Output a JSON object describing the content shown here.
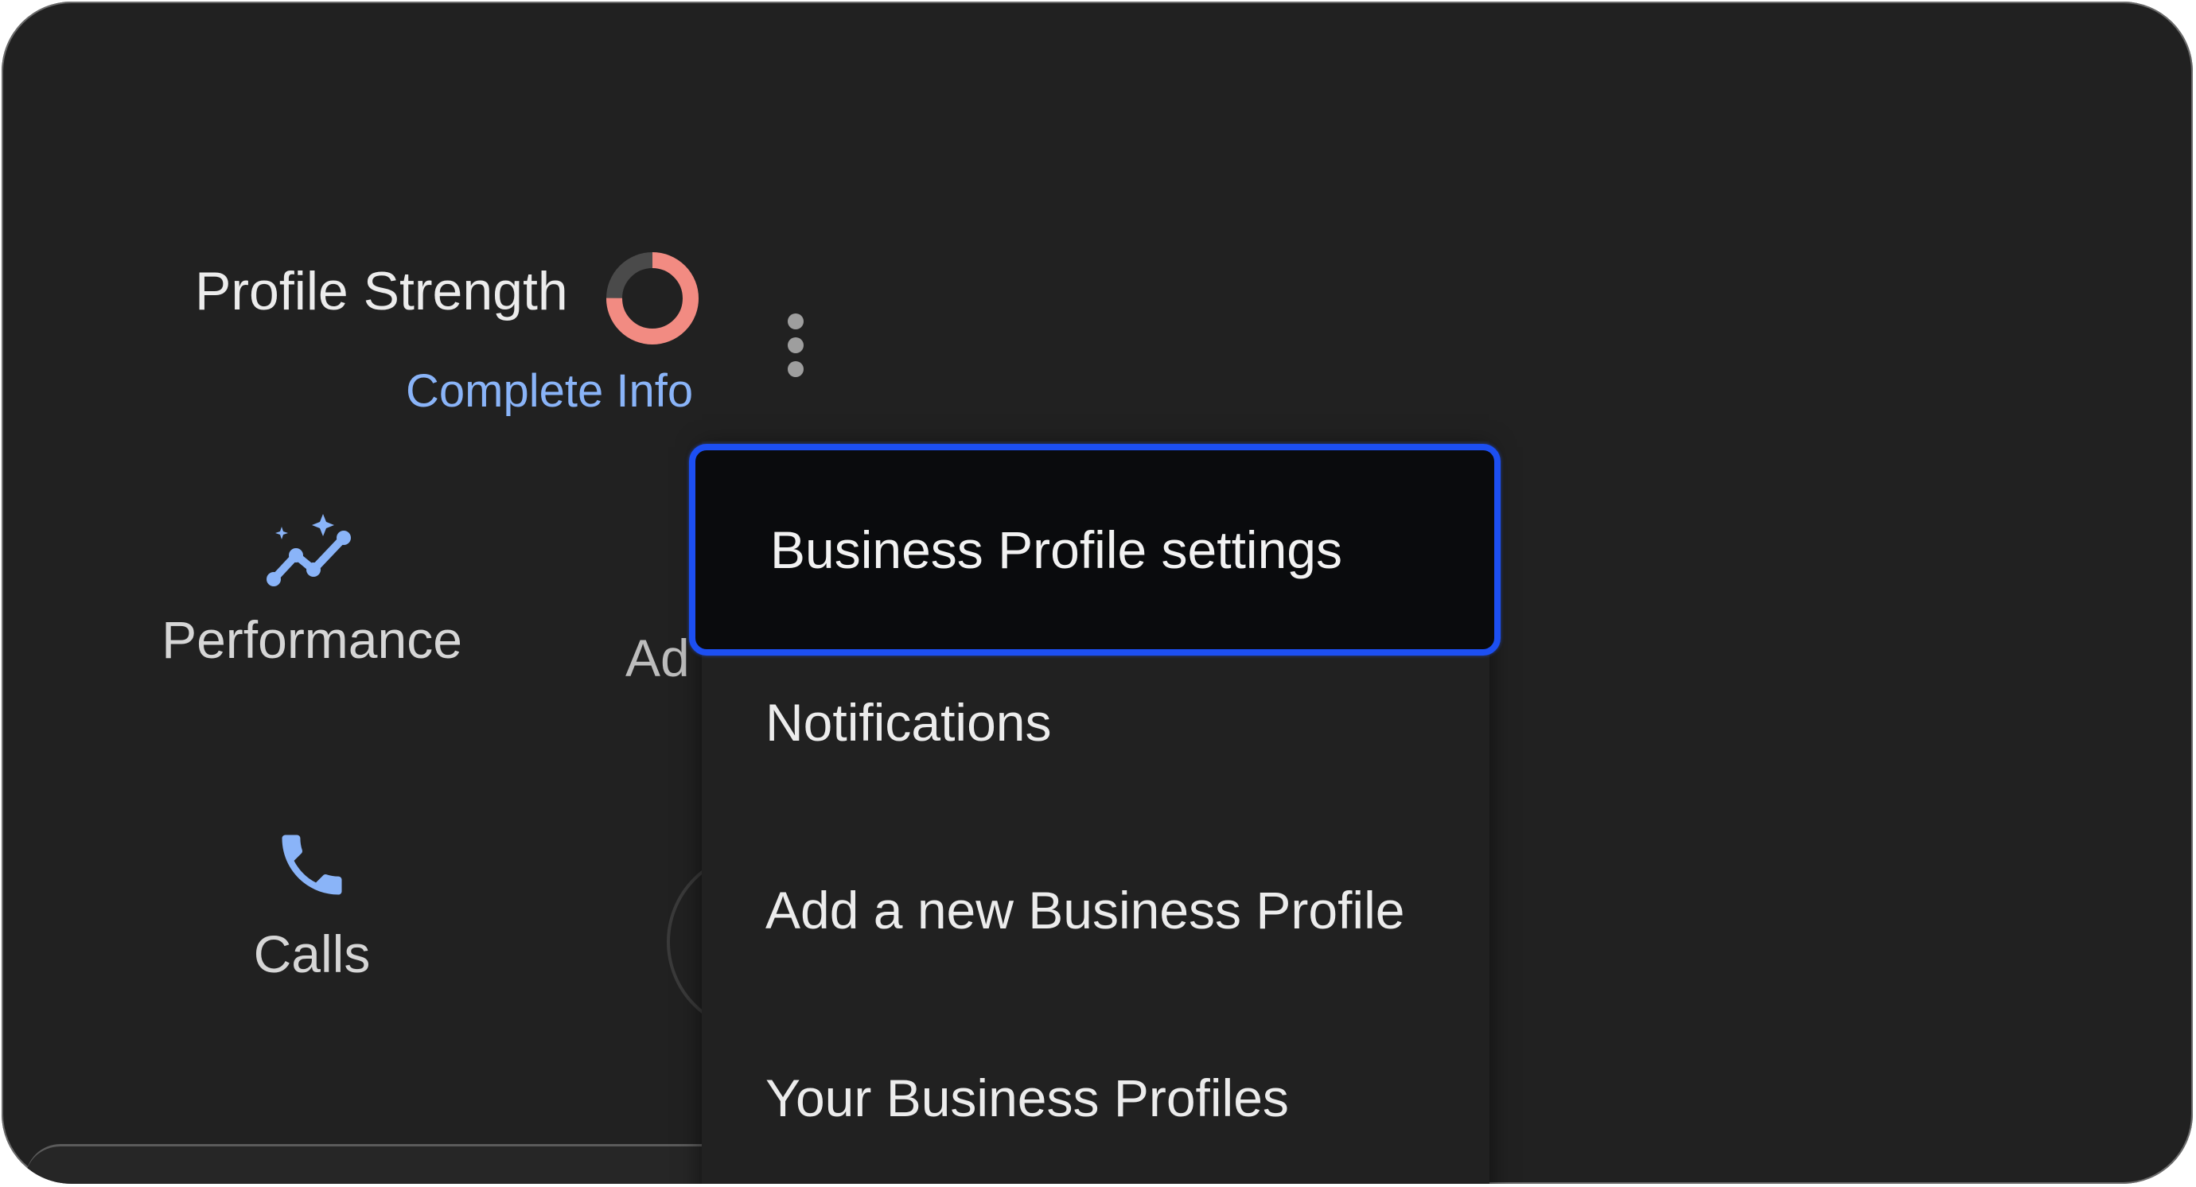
{
  "profile_strength": {
    "label": "Profile Strength",
    "link_label": "Complete Info",
    "progress_fraction": 0.75,
    "ring_color": "#f28b82",
    "ring_track_color": "#4a4a4a"
  },
  "overflow_menu": {
    "icon": "more-vert-icon",
    "items": [
      {
        "label": "Business Profile settings",
        "highlighted": true
      },
      {
        "label": "Notifications"
      },
      {
        "label": "Add a new Business Profile"
      },
      {
        "label": "Your Business Profiles"
      }
    ]
  },
  "tiles": {
    "performance": {
      "label": "Performance",
      "icon": "insights-icon"
    },
    "ad": {
      "label": "Ad"
    },
    "calls": {
      "label": "Calls",
      "icon": "phone-icon"
    }
  },
  "colors": {
    "background": "#212121",
    "accent": "#8ab4f8",
    "highlight_border": "#1c4ff2"
  }
}
